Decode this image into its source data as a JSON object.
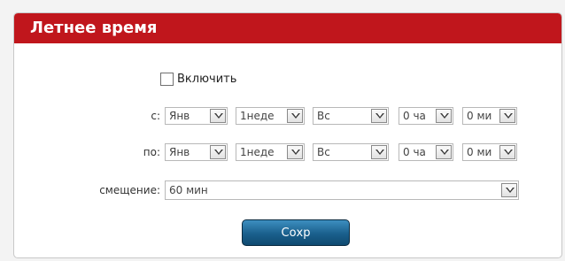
{
  "panel": {
    "title": "Летнее время",
    "header_color": "#c0161c"
  },
  "enable": {
    "label": "Включить",
    "checked": false
  },
  "from": {
    "label": "с:",
    "month": "Янв",
    "week": "1неде",
    "day": "Вс",
    "hour": "0 ча",
    "minute": "0 ми"
  },
  "to": {
    "label": "по:",
    "month": "Янв",
    "week": "1неде",
    "day": "Вс",
    "hour": "0 ча",
    "minute": "0 ми"
  },
  "offset": {
    "label": "смещение:",
    "value": "60 мин"
  },
  "save_button": {
    "label": "Сохр",
    "color": "#1a5f8c"
  }
}
